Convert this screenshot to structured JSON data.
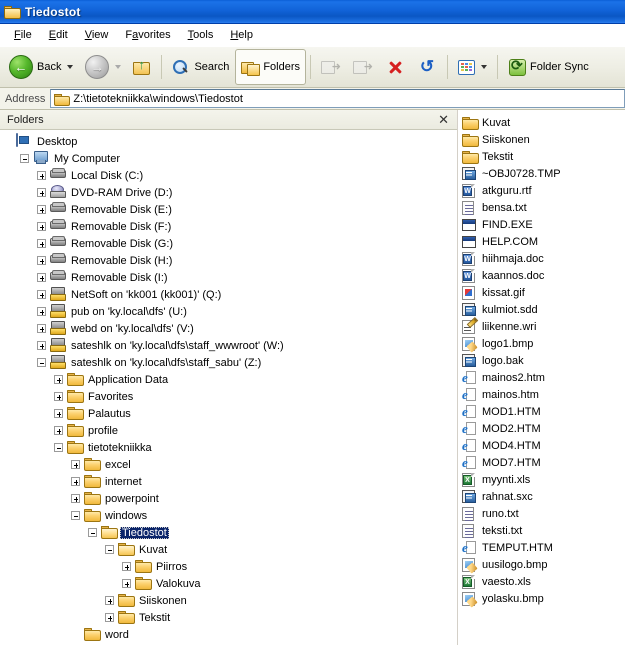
{
  "window": {
    "title": "Tiedostot",
    "title_icon": "folder-icon"
  },
  "menubar": {
    "items": [
      {
        "label": "File",
        "accel": "F"
      },
      {
        "label": "Edit",
        "accel": "E"
      },
      {
        "label": "View",
        "accel": "V"
      },
      {
        "label": "Favorites",
        "accel": "a"
      },
      {
        "label": "Tools",
        "accel": "T"
      },
      {
        "label": "Help",
        "accel": "H"
      }
    ]
  },
  "toolbar": {
    "back_label": "Back",
    "back_icon": "back-arrow-icon",
    "forward_icon": "forward-arrow-icon",
    "up_icon": "up-folder-icon",
    "search_label": "Search",
    "search_icon": "search-icon",
    "folders_label": "Folders",
    "folders_icon": "folders-icon",
    "moveto_icon": "move-to-icon",
    "copyto_icon": "copy-to-icon",
    "delete_icon": "delete-x-icon",
    "undo_icon": "undo-arrow-icon",
    "views_icon": "views-grid-icon",
    "foldersync_label": "Folder Sync",
    "foldersync_icon": "folder-sync-icon"
  },
  "address": {
    "label": "Address",
    "value": "Z:\\tietotekniikka\\windows\\Tiedostot",
    "icon": "folder-icon"
  },
  "folders_pane": {
    "title": "Folders",
    "close_icon": "close-icon",
    "tree": [
      {
        "label": "Desktop",
        "indent": 0,
        "toggle": "none",
        "icon": "desktop-icon"
      },
      {
        "label": "My Computer",
        "indent": 1,
        "toggle": "minus",
        "icon": "my-computer-icon"
      },
      {
        "label": "Local Disk (C:)",
        "indent": 2,
        "toggle": "plus",
        "icon": "hard-disk-icon"
      },
      {
        "label": "DVD-RAM Drive (D:)",
        "indent": 2,
        "toggle": "plus",
        "icon": "dvd-drive-icon"
      },
      {
        "label": "Removable Disk (E:)",
        "indent": 2,
        "toggle": "plus",
        "icon": "hard-disk-icon"
      },
      {
        "label": "Removable Disk (F:)",
        "indent": 2,
        "toggle": "plus",
        "icon": "hard-disk-icon"
      },
      {
        "label": "Removable Disk (G:)",
        "indent": 2,
        "toggle": "plus",
        "icon": "hard-disk-icon"
      },
      {
        "label": "Removable Disk (H:)",
        "indent": 2,
        "toggle": "plus",
        "icon": "hard-disk-icon"
      },
      {
        "label": "Removable Disk (I:)",
        "indent": 2,
        "toggle": "plus",
        "icon": "hard-disk-icon"
      },
      {
        "label": "NetSoft on 'kk001 (kk001)' (Q:)",
        "indent": 2,
        "toggle": "plus",
        "icon": "network-drive-icon"
      },
      {
        "label": "pub on 'ky.local\\dfs' (U:)",
        "indent": 2,
        "toggle": "plus",
        "icon": "network-drive-icon"
      },
      {
        "label": "webd on 'ky.local\\dfs' (V:)",
        "indent": 2,
        "toggle": "plus",
        "icon": "network-drive-icon"
      },
      {
        "label": "sateshlk on 'ky.local\\dfs\\staff_wwwroot' (W:)",
        "indent": 2,
        "toggle": "plus",
        "icon": "network-drive-icon"
      },
      {
        "label": "sateshlk on 'ky.local\\dfs\\staff_sabu' (Z:)",
        "indent": 2,
        "toggle": "minus",
        "icon": "network-drive-icon"
      },
      {
        "label": "Application Data",
        "indent": 3,
        "toggle": "plus",
        "icon": "folder-icon"
      },
      {
        "label": "Favorites",
        "indent": 3,
        "toggle": "plus",
        "icon": "folder-icon"
      },
      {
        "label": "Palautus",
        "indent": 3,
        "toggle": "plus",
        "icon": "folder-icon"
      },
      {
        "label": "profile",
        "indent": 3,
        "toggle": "plus",
        "icon": "folder-icon"
      },
      {
        "label": "tietotekniikka",
        "indent": 3,
        "toggle": "minus",
        "icon": "folder-icon"
      },
      {
        "label": "excel",
        "indent": 4,
        "toggle": "plus",
        "icon": "folder-icon"
      },
      {
        "label": "internet",
        "indent": 4,
        "toggle": "plus",
        "icon": "folder-icon"
      },
      {
        "label": "powerpoint",
        "indent": 4,
        "toggle": "plus",
        "icon": "folder-icon"
      },
      {
        "label": "windows",
        "indent": 4,
        "toggle": "minus",
        "icon": "folder-icon"
      },
      {
        "label": "Tiedostot",
        "indent": 5,
        "toggle": "minus",
        "icon": "folder-open-icon",
        "selected": true
      },
      {
        "label": "Kuvat",
        "indent": 6,
        "toggle": "minus",
        "icon": "folder-open-icon"
      },
      {
        "label": "Piirros",
        "indent": 7,
        "toggle": "plus",
        "icon": "folder-icon"
      },
      {
        "label": "Valokuva",
        "indent": 7,
        "toggle": "plus",
        "icon": "folder-icon"
      },
      {
        "label": "Siiskonen",
        "indent": 6,
        "toggle": "plus",
        "icon": "folder-icon"
      },
      {
        "label": "Tekstit",
        "indent": 6,
        "toggle": "plus",
        "icon": "folder-icon"
      },
      {
        "label": "word",
        "indent": 4,
        "toggle": "none",
        "icon": "folder-icon"
      }
    ]
  },
  "file_list": {
    "items": [
      {
        "name": "Kuvat",
        "icon": "folder-icon"
      },
      {
        "name": "Siiskonen",
        "icon": "folder-icon"
      },
      {
        "name": "Tekstit",
        "icon": "folder-icon"
      },
      {
        "name": "~OBJ0728.TMP",
        "icon": "tmp-file-icon"
      },
      {
        "name": "atkguru.rtf",
        "icon": "word-document-icon"
      },
      {
        "name": "bensa.txt",
        "icon": "text-file-icon"
      },
      {
        "name": "FIND.EXE",
        "icon": "application-icon"
      },
      {
        "name": "HELP.COM",
        "icon": "application-icon"
      },
      {
        "name": "hiihmaja.doc",
        "icon": "word-document-icon"
      },
      {
        "name": "kaannos.doc",
        "icon": "word-document-icon"
      },
      {
        "name": "kissat.gif",
        "icon": "gif-image-icon"
      },
      {
        "name": "kulmiot.sdd",
        "icon": "tmp-file-icon"
      },
      {
        "name": "liikenne.wri",
        "icon": "write-document-icon"
      },
      {
        "name": "logo1.bmp",
        "icon": "bitmap-image-icon"
      },
      {
        "name": "logo.bak",
        "icon": "tmp-file-icon"
      },
      {
        "name": "mainos2.htm",
        "icon": "html-document-icon"
      },
      {
        "name": "mainos.htm",
        "icon": "html-document-icon"
      },
      {
        "name": "MOD1.HTM",
        "icon": "html-document-icon"
      },
      {
        "name": "MOD2.HTM",
        "icon": "html-document-icon"
      },
      {
        "name": "MOD4.HTM",
        "icon": "html-document-icon"
      },
      {
        "name": "MOD7.HTM",
        "icon": "html-document-icon"
      },
      {
        "name": "myynti.xls",
        "icon": "excel-document-icon"
      },
      {
        "name": "rahnat.sxc",
        "icon": "tmp-file-icon"
      },
      {
        "name": "runo.txt",
        "icon": "text-file-icon"
      },
      {
        "name": "teksti.txt",
        "icon": "text-file-icon"
      },
      {
        "name": "TEMPUT.HTM",
        "icon": "html-document-icon"
      },
      {
        "name": "uusilogo.bmp",
        "icon": "bitmap-image-icon"
      },
      {
        "name": "vaesto.xls",
        "icon": "excel-document-icon"
      },
      {
        "name": "yolasku.bmp",
        "icon": "bitmap-image-icon"
      }
    ]
  },
  "colors": {
    "titlebar_blue": "#1163d8",
    "selection_navy": "#0a246a",
    "toolbar_beige": "#eeeee4"
  }
}
